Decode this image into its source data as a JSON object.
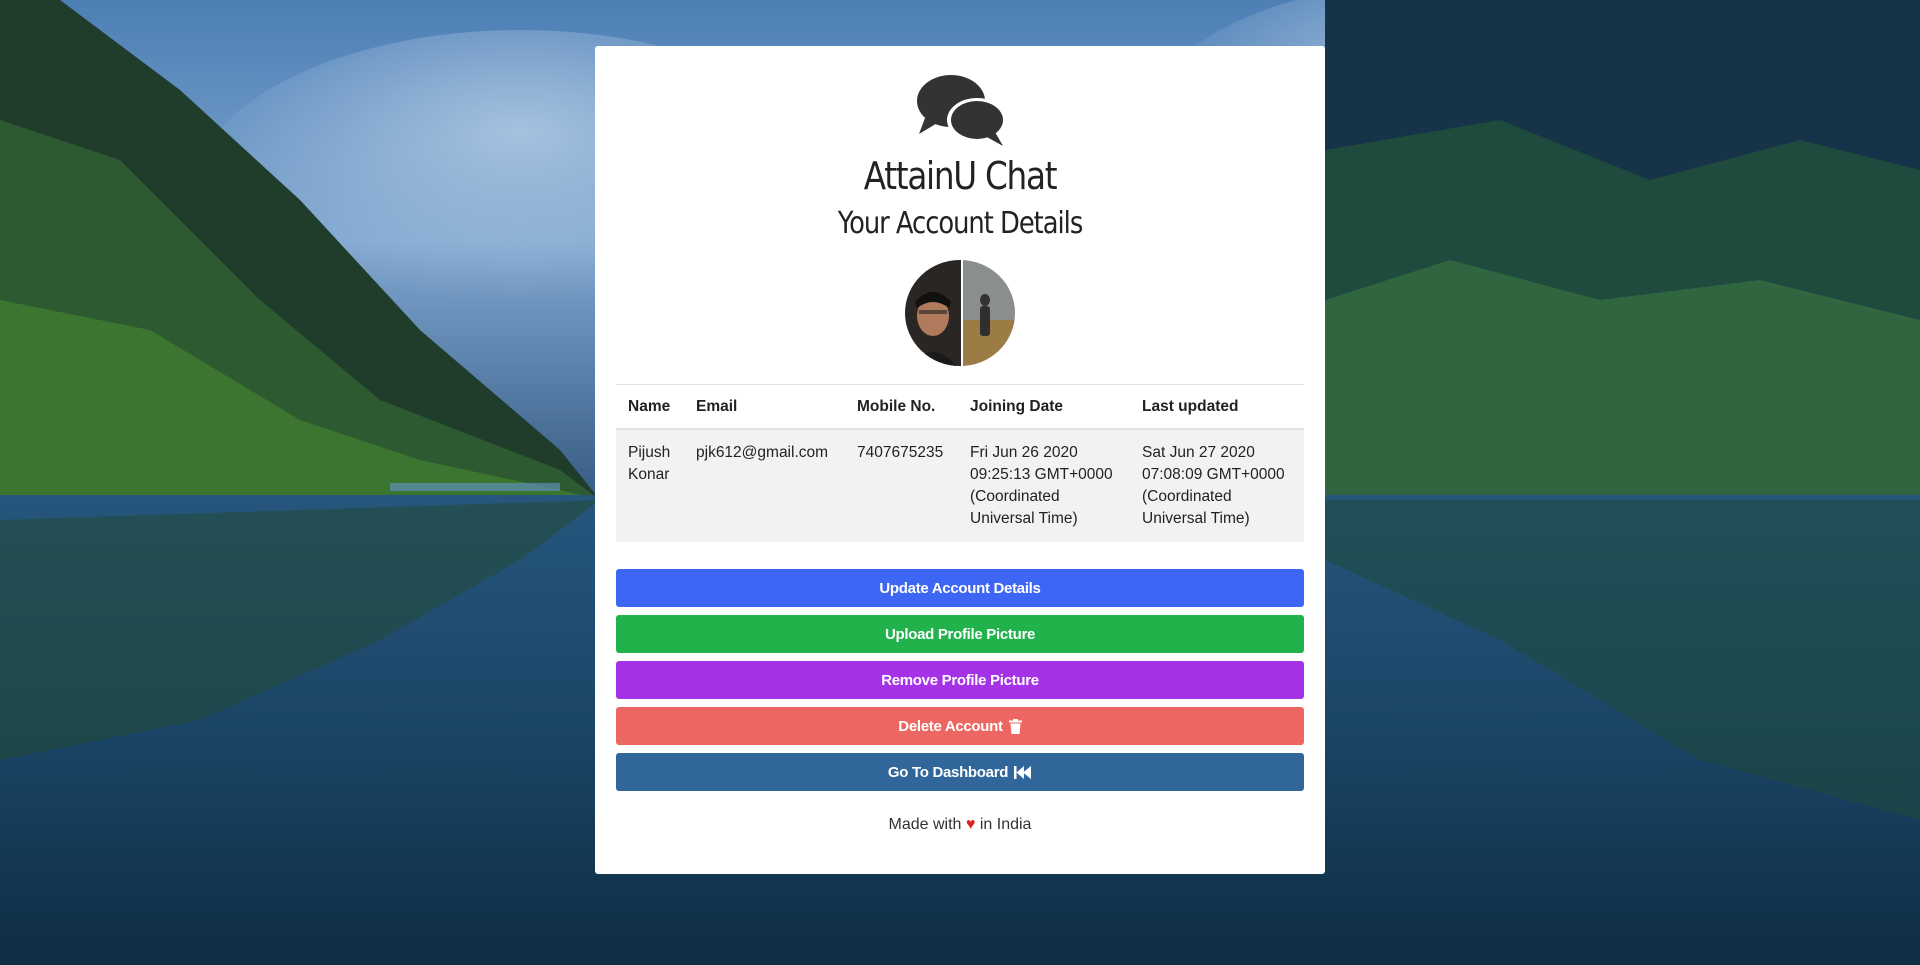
{
  "app": {
    "title": "AttainU Chat",
    "subtitle": "Your Account Details"
  },
  "table": {
    "headers": [
      "Name",
      "Email",
      "Mobile No.",
      "Joining Date",
      "Last updated"
    ],
    "row": {
      "name": "Pijush Konar",
      "email": "pjk612@gmail.com",
      "mobile": "7407675235",
      "joining_date": "Fri Jun 26 2020 09:25:13 GMT+0000 (Coordinated Universal Time)",
      "last_updated": "Sat Jun 27 2020 07:08:09 GMT+0000 (Coordinated Universal Time)"
    }
  },
  "buttons": {
    "update": "Update Account Details",
    "upload": "Upload Profile Picture",
    "remove": "Remove Profile Picture",
    "delete": "Delete Account",
    "dashboard": "Go To Dashboard"
  },
  "footer": {
    "prefix": "Made with",
    "heart": "♥",
    "suffix": "in India"
  },
  "colors": {
    "update": "#3e66f4",
    "upload": "#22b24c",
    "remove": "#a632e8",
    "delete": "#ec6762",
    "dashboard": "#31669b"
  },
  "icons": {
    "logo": "comments-icon",
    "delete": "trash-icon",
    "dashboard": "backward-icon"
  }
}
